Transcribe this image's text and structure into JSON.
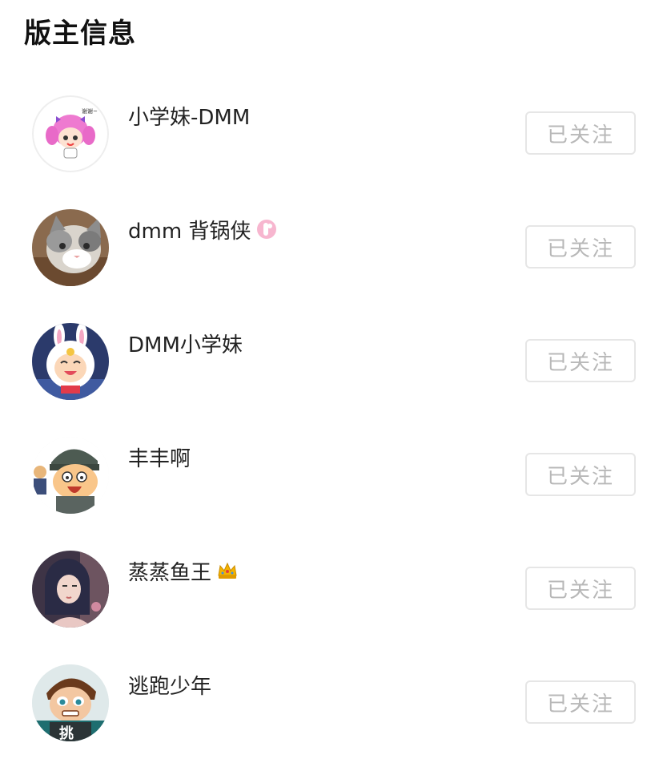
{
  "header": {
    "title": "版主信息"
  },
  "moderators": [
    {
      "name": "小学妹-DMM",
      "follow_label": "已关注",
      "avatar_icon": "anime-girl-pink-hair-avatar",
      "badge": null
    },
    {
      "name": "dmm 背锅侠",
      "follow_label": "已关注",
      "avatar_icon": "cat-photo-avatar",
      "badge": "pink-wrench-badge"
    },
    {
      "name": "DMM小学妹",
      "follow_label": "已关注",
      "avatar_icon": "bunny-hood-character-avatar",
      "badge": null
    },
    {
      "name": "丰丰啊",
      "follow_label": "已关注",
      "avatar_icon": "cartoon-guy-beanie-avatar",
      "badge": null
    },
    {
      "name": "蒸蒸鱼王",
      "follow_label": "已关注",
      "avatar_icon": "illustrated-woman-avatar",
      "badge": "crown-emoji"
    },
    {
      "name": "逃跑少年",
      "follow_label": "已关注",
      "avatar_icon": "game-boy-character-avatar",
      "badge": null
    }
  ],
  "colors": {
    "button_border": "#e6e6e6",
    "button_text": "#b8b8b8",
    "name_text": "#222222"
  }
}
